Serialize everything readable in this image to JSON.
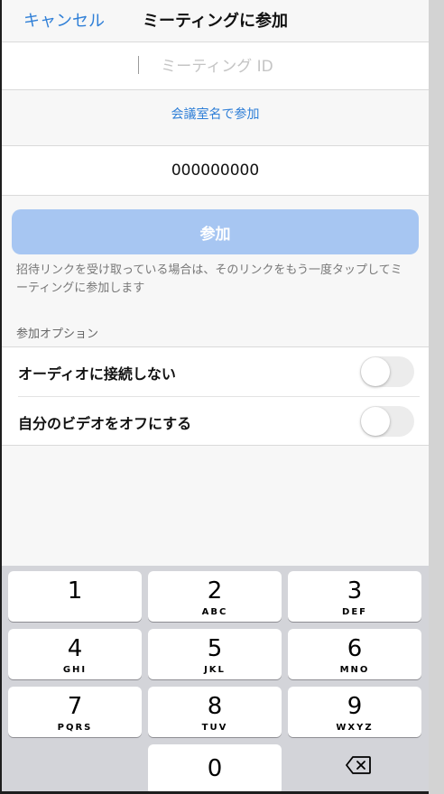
{
  "header": {
    "cancel_label": "キャンセル",
    "title": "ミーティングに参加"
  },
  "meeting_id": {
    "placeholder": "ミーティング ID",
    "value": ""
  },
  "join_by_room_name": "会議室名で参加",
  "personal_meeting_id": "000000000",
  "join_button_label": "参加",
  "hint_text": "招待リンクを受け取っている場合は、そのリンクをもう一度タップしてミーティングに参加します",
  "options": {
    "section_title": "参加オプション",
    "items": [
      {
        "label": "オーディオに接続しない",
        "enabled": false
      },
      {
        "label": "自分のビデオをオフにする",
        "enabled": false
      }
    ]
  },
  "keypad": {
    "keys": [
      {
        "num": "1",
        "letters": ""
      },
      {
        "num": "2",
        "letters": "ABC"
      },
      {
        "num": "3",
        "letters": "DEF"
      },
      {
        "num": "4",
        "letters": "GHI"
      },
      {
        "num": "5",
        "letters": "JKL"
      },
      {
        "num": "6",
        "letters": "MNO"
      },
      {
        "num": "7",
        "letters": "PQRS"
      },
      {
        "num": "8",
        "letters": "TUV"
      },
      {
        "num": "9",
        "letters": "WXYZ"
      },
      {
        "num": "0",
        "letters": ""
      }
    ],
    "backspace_icon": "backspace-icon"
  },
  "colors": {
    "accent": "#2f7fd7",
    "join_button_disabled": "#a7c6f2",
    "keyboard_bg": "#d3d4d9"
  }
}
